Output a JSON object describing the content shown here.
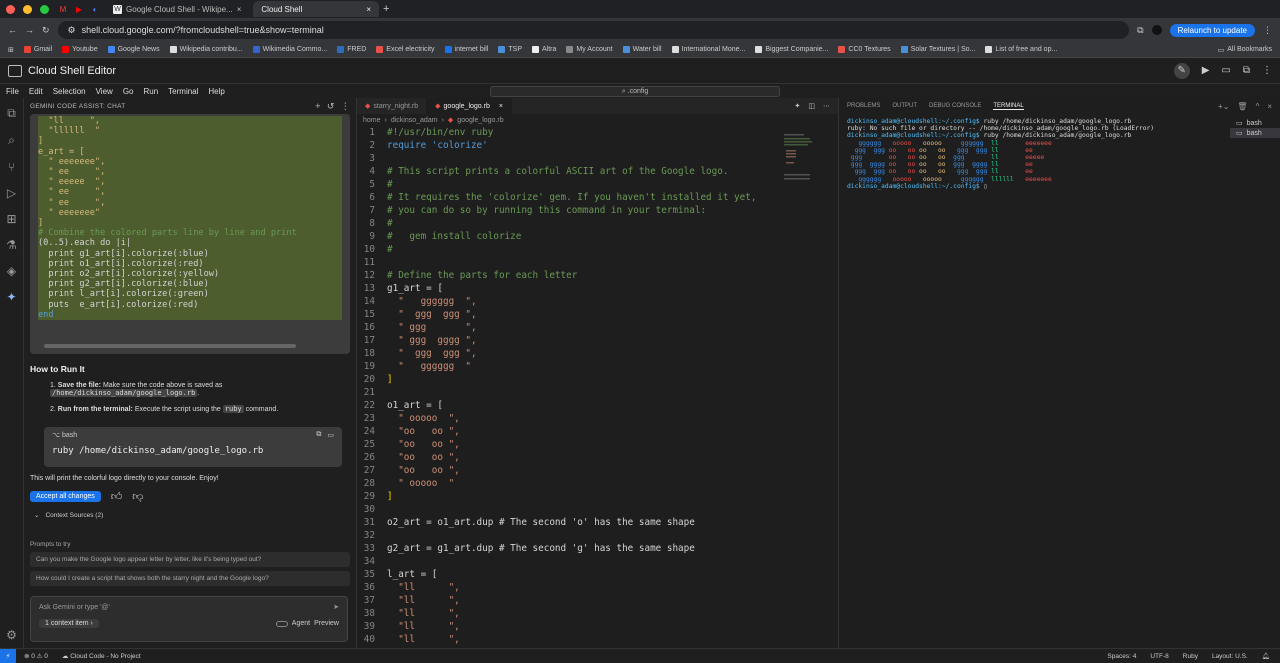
{
  "browser": {
    "tabs": [
      {
        "label": "Google Cloud Shell - Wikipe...",
        "active": false
      },
      {
        "label": "Cloud Shell",
        "active": true
      }
    ],
    "url": "shell.cloud.google.com/?fromcloudshell=true&show=terminal",
    "relaunch": "Relaunch to update",
    "bookmarks": [
      "Gmail",
      "Youtube",
      "Google News",
      "Wikipedia contribu...",
      "Wikimedia Commo...",
      "FRED",
      "Excel electricity",
      "internet bill",
      "TSP",
      "Altra",
      "My Account",
      "Water bill",
      "International Mone...",
      "Biggest Companie...",
      "CC0 Textures",
      "Solar Textures | So...",
      "List of free and op..."
    ],
    "all_bookmarks": "All Bookmarks"
  },
  "app": {
    "title": "Cloud Shell Editor",
    "menu": [
      "File",
      "Edit",
      "Selection",
      "View",
      "Go",
      "Run",
      "Terminal",
      "Help"
    ],
    "command_center": ".config"
  },
  "chat": {
    "header": "GEMINI CODE ASSIST: CHAT",
    "code_lines": [
      "  \"ll     \",",
      "  \"llllll  \"",
      "]",
      "",
      "e_art = [",
      "  \" eeeeeee\",",
      "  \" ee     \",",
      "  \" eeeee  \",",
      "  \" ee     \",",
      "  \" ee     \",",
      "  \" eeeeeee\"",
      "]",
      "",
      "# Combine the colored parts line by line and print",
      "(0..5).each do |i|",
      "  print g1_art[i].colorize(:blue)",
      "  print o1_art[i].colorize(:red)",
      "  print o2_art[i].colorize(:yellow)",
      "  print g2_art[i].colorize(:blue)",
      "  print l_art[i].colorize(:green)",
      "  puts  e_art[i].colorize(:red)",
      "end"
    ],
    "howto_title": "How to Run It",
    "step1_label": "Save the file:",
    "step1_text": "Make sure the code above is saved as",
    "step1_code": "/home/dickinso_adam/google_logo.rb",
    "step2_label": "Run from the terminal:",
    "step2_text": "Execute the script using the",
    "step2_code": "ruby",
    "step2_suffix": "command.",
    "bash_label": "bash",
    "bash_command": "ruby /home/dickinso_adam/google_logo.rb",
    "result_text": "This will print the colorful logo directly to your console. Enjoy!",
    "accept_label": "Accept all changes",
    "context_sources": "Context Sources (2)",
    "prompts_title": "Prompts to try",
    "prompts": [
      "Can you make the Google logo appear letter by letter, like it's being typed out?",
      "How could I create a script that shows both the starry night and the Google logo?"
    ],
    "input_placeholder": "Ask Gemini or type '@'",
    "context_item": "1 context item",
    "agent_label": "Agent",
    "preview_label": "Preview"
  },
  "editor": {
    "tabs": [
      {
        "label": "starry_night.rb",
        "active": false
      },
      {
        "label": "google_logo.rb",
        "active": true
      }
    ],
    "breadcrumb": [
      "home",
      "dickinso_adam",
      "google_logo.rb"
    ],
    "lines": [
      "#!/usr/bin/env ruby",
      "require 'colorize'",
      "",
      "# This script prints a colorful ASCII art of the Google logo.",
      "#",
      "# It requires the 'colorize' gem. If you haven't installed it yet,",
      "# you can do so by running this command in your terminal:",
      "#",
      "#   gem install colorize",
      "#",
      "",
      "# Define the parts for each letter",
      "g1_art = [",
      "  \"   gggggg  \",",
      "  \"  ggg  ggg \",",
      "  \" ggg       \",",
      "  \" ggg  gggg \",",
      "  \"  ggg  ggg \",",
      "  \"   gggggg  \"",
      "]",
      "",
      "o1_art = [",
      "  \" ooooo  \",",
      "  \"oo   oo \",",
      "  \"oo   oo \",",
      "  \"oo   oo \",",
      "  \"oo   oo \",",
      "  \" ooooo  \"",
      "]",
      "",
      "o2_art = o1_art.dup # The second 'o' has the same shape",
      "",
      "g2_art = g1_art.dup # The second 'g' has the same shape",
      "",
      "l_art = [",
      "  \"ll      \",",
      "  \"ll      \",",
      "  \"ll      \",",
      "  \"ll      \",",
      "  \"ll      \","
    ]
  },
  "terminal": {
    "tabs": [
      "PROBLEMS",
      "OUTPUT",
      "DEBUG CONSOLE",
      "TERMINAL"
    ],
    "prompt": "dickinso_adam@cloudshell:~/.config$",
    "cmd1": "ruby /home/dickinso_adam/google_logo.rb",
    "error": "ruby: No such file or directory -- /home/dickinso_adam/google_logo.rb (LoadError)",
    "cmd2": "ruby /home/dickinso_adam/google_logo.rb",
    "logo_lines": [
      {
        "g1": "   gggggg  ",
        "o1": " ooooo  ",
        "o2": " ooooo  ",
        "g2": "   gggggg  ",
        "l": "ll      ",
        "e": " eeeeeee"
      },
      {
        "g1": "  ggg  ggg ",
        "o1": "oo   oo ",
        "o2": "oo   oo ",
        "g2": "  ggg  ggg ",
        "l": "ll      ",
        "e": " ee     "
      },
      {
        "g1": " ggg       ",
        "o1": "oo   oo ",
        "o2": "oo   oo ",
        "g2": " ggg       ",
        "l": "ll      ",
        "e": " eeeee  "
      },
      {
        "g1": " ggg  gggg ",
        "o1": "oo   oo ",
        "o2": "oo   oo ",
        "g2": " ggg  gggg ",
        "l": "ll      ",
        "e": " ee     "
      },
      {
        "g1": "  ggg  ggg ",
        "o1": "oo   oo ",
        "o2": "oo   oo ",
        "g2": "  ggg  ggg ",
        "l": "ll      ",
        "e": " ee     "
      },
      {
        "g1": "   gggggg  ",
        "o1": " ooooo  ",
        "o2": " ooooo  ",
        "g2": "   gggggg  ",
        "l": "llllll  ",
        "e": " eeeeeee"
      }
    ],
    "sessions": [
      "bash",
      "bash"
    ]
  },
  "status": {
    "left": "⊗ 0 ⚠ 0",
    "cloud": "Cloud Code - No Project",
    "spaces": "Spaces: 4",
    "encoding": "UTF-8",
    "language": "Ruby",
    "layout": "Layout: U.S."
  }
}
